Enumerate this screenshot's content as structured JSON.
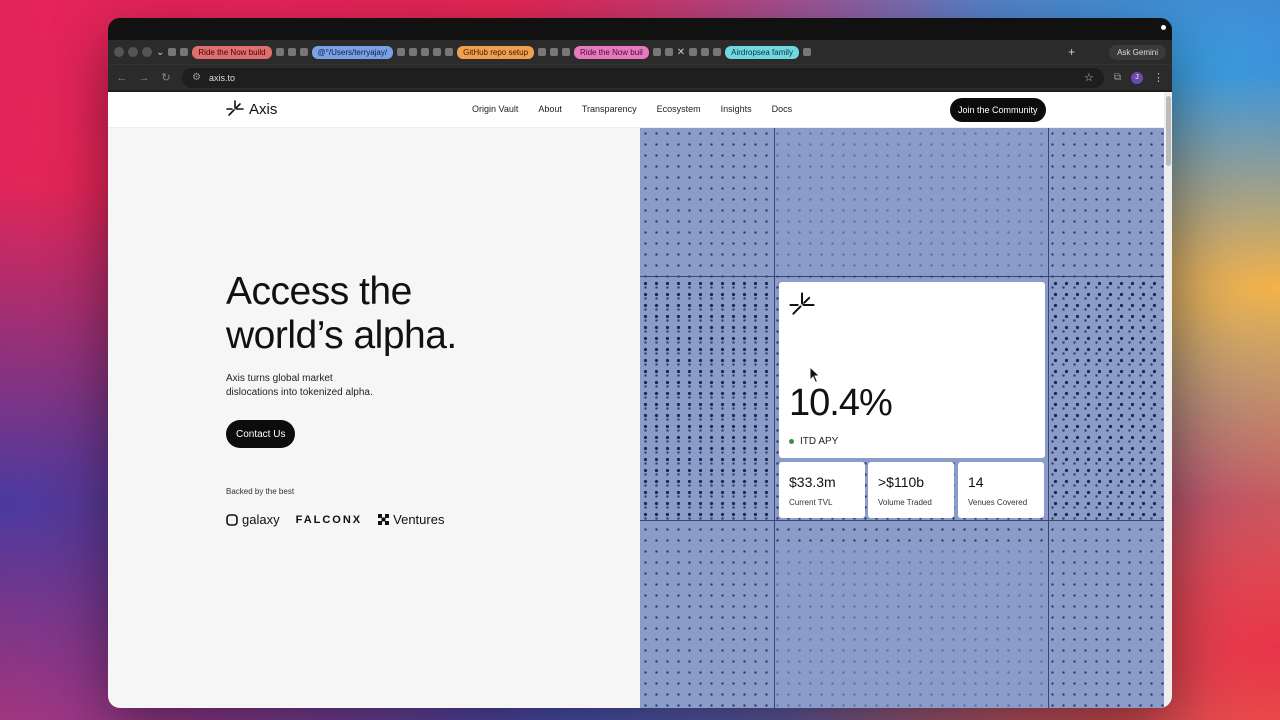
{
  "browser": {
    "tabs": [
      {
        "label": "Ride the Now build",
        "color": "red"
      },
      {
        "label": "@°/Users/terryajay/",
        "color": "blue"
      },
      {
        "label": "GitHub repo setup",
        "color": "orange"
      },
      {
        "label": "Ride the Now buil",
        "color": "pink"
      },
      {
        "label": "Airdropsea family",
        "color": "cyan"
      }
    ],
    "ask_gemini": "Ask Gemini",
    "url": "axis.to",
    "profile_initial": "J"
  },
  "site": {
    "brand": "Axis",
    "nav": [
      "Origin Vault",
      "About",
      "Transparency",
      "Ecosystem",
      "Insights",
      "Docs"
    ],
    "join_label": "Join the Community",
    "hero_title_line1": "Access the",
    "hero_title_line2": "world’s alpha.",
    "hero_sub_line1": "Axis turns global market",
    "hero_sub_line2": "dislocations into tokenized alpha.",
    "contact_label": "Contact Us",
    "backed_label": "Backed by the best",
    "backers": [
      "galaxy",
      "FALCONX",
      "Ventures"
    ],
    "apy_value": "10.4%",
    "apy_label": "ITD APY",
    "stats": [
      {
        "value": "$33.3m",
        "label": "Current TVL"
      },
      {
        "value": ">$110b",
        "label": "Volume Traded"
      },
      {
        "value": "14",
        "label": "Venues Covered"
      }
    ]
  },
  "colors": {
    "pattern_bg": "#8b9cc9",
    "pattern_dot": "#2a3468",
    "button_bg": "#0c0c0c",
    "apy_dot": "#3c8a4a"
  }
}
